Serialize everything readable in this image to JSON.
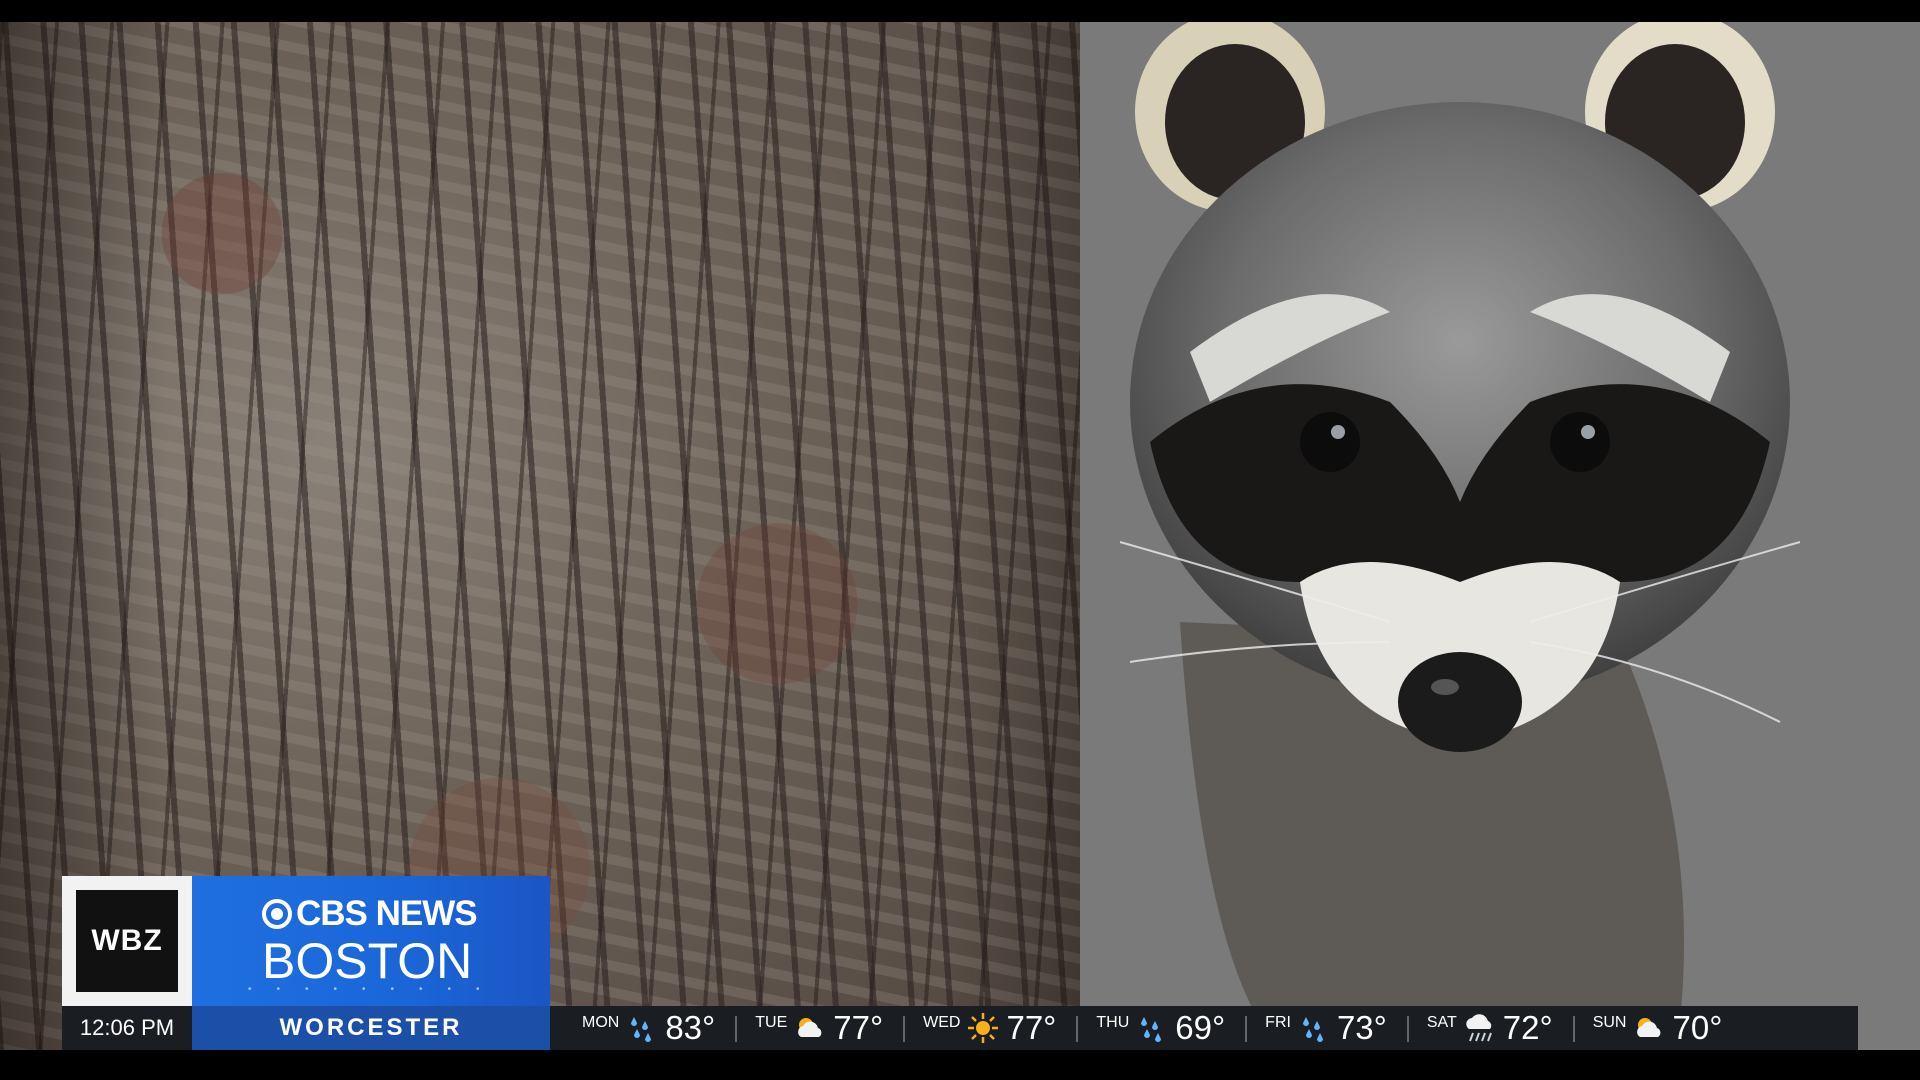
{
  "station": {
    "logo_text": "WBZ",
    "network": "CBS NEWS",
    "city": "BOSTON"
  },
  "ticker": {
    "time": "12:06 PM",
    "location": "WORCESTER",
    "forecast": [
      {
        "day": "MON",
        "icon": "rain-icon",
        "temp": "83°"
      },
      {
        "day": "TUE",
        "icon": "partly-cloudy-icon",
        "temp": "77°"
      },
      {
        "day": "WED",
        "icon": "sun-icon",
        "temp": "77°"
      },
      {
        "day": "THU",
        "icon": "rain-icon",
        "temp": "69°"
      },
      {
        "day": "FRI",
        "icon": "rain-icon",
        "temp": "73°"
      },
      {
        "day": "SAT",
        "icon": "rain-cloud-icon",
        "temp": "72°"
      },
      {
        "day": "SUN",
        "icon": "partly-cloudy-icon",
        "temp": "70°"
      }
    ]
  },
  "colors": {
    "cbs_blue": "#1f6fe0",
    "location_blue": "#1c4fa8",
    "ticker_bg": "#1a1d22"
  }
}
